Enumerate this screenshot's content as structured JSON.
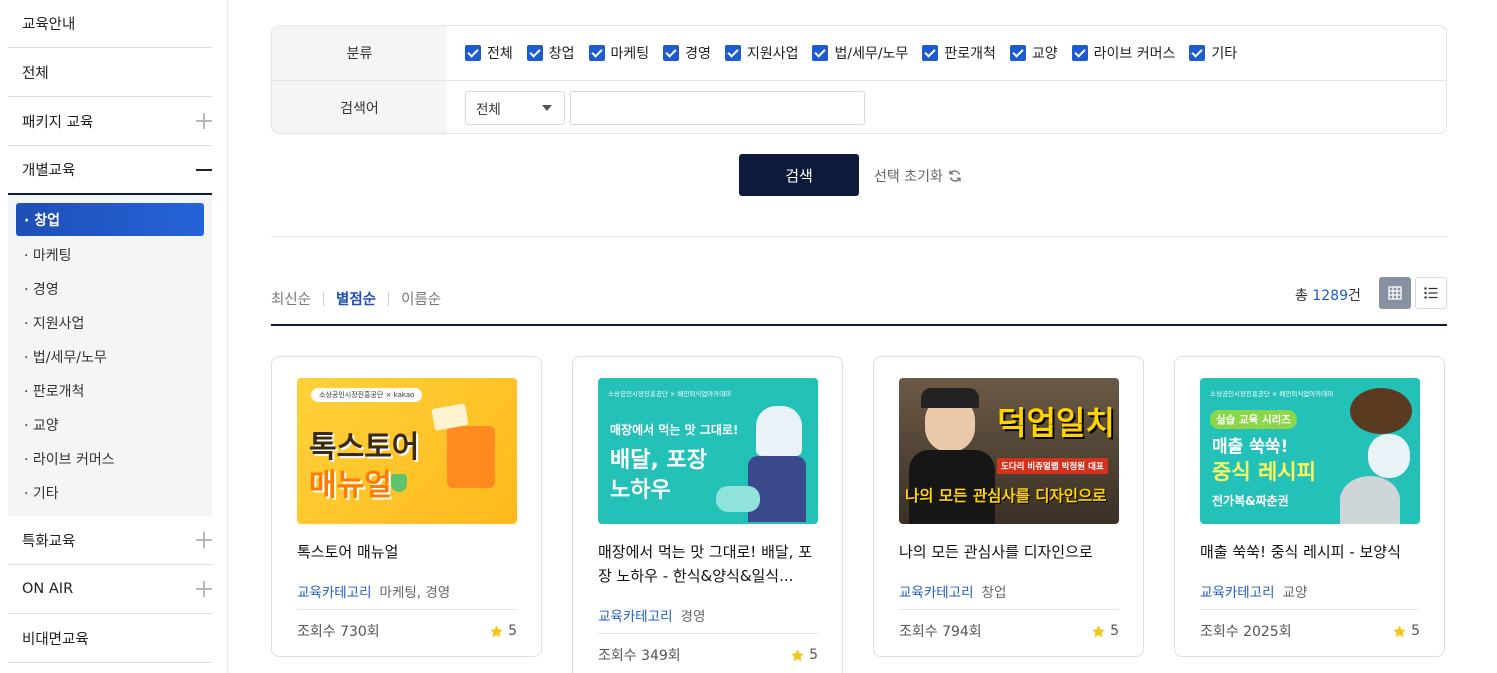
{
  "sidebar": {
    "items": [
      {
        "label": "교육안내"
      },
      {
        "label": "전체"
      },
      {
        "label": "패키지 교육"
      },
      {
        "label": "개별교육"
      },
      {
        "label": "특화교육"
      },
      {
        "label": "ON AIR"
      },
      {
        "label": "비대면교육"
      }
    ],
    "sub_items": [
      {
        "label": "· 창업"
      },
      {
        "label": "· 마케팅"
      },
      {
        "label": "· 경영"
      },
      {
        "label": "· 지원사업"
      },
      {
        "label": "· 법/세무/노무"
      },
      {
        "label": "· 판로개척"
      },
      {
        "label": "· 교양"
      },
      {
        "label": "· 라이브 커머스"
      },
      {
        "label": "· 기타"
      }
    ]
  },
  "filter": {
    "category_label": "분류",
    "categories": [
      "전체",
      "창업",
      "마케팅",
      "경영",
      "지원사업",
      "법/세무/노무",
      "판로개척",
      "교양",
      "라이브 커머스",
      "기타"
    ],
    "keyword_label": "검색어",
    "keyword_select": "전체",
    "keyword_value": ""
  },
  "actions": {
    "search": "검색",
    "reset": "선택 초기화"
  },
  "sort": {
    "options": [
      "최신순",
      "별점순",
      "이름순"
    ],
    "active": "별점순"
  },
  "total": {
    "prefix": "총 ",
    "count": "1289",
    "suffix": "건"
  },
  "colors": {
    "navy": "#0e1a3a",
    "accent": "#1f5bd0",
    "star": "#f5c518"
  },
  "cards": [
    {
      "title": "톡스토어 매뉴얼",
      "category_label": "교육카테고리",
      "category": "마케팅, 경영",
      "views": "조회수 730회",
      "rating": "5",
      "thumb": {
        "logos": "소상공인시장진흥공단 × kakao",
        "line1": "톡스토어",
        "line2": "매뉴얼"
      }
    },
    {
      "title": "매장에서 먹는 맛 그대로! 배달, 포장 노하우 - 한식&양식&일식...",
      "category_label": "교육카테고리",
      "category": "경영",
      "views": "조회수 349회",
      "rating": "5",
      "thumb": {
        "logos": "소상공인시장진흥공단 × 배민외식업아카데미",
        "line1": "매장에서 먹는 맛 그대로!",
        "line2": "배달, 포장",
        "line3": "노하우"
      }
    },
    {
      "title": "나의 모든 관심사를 디자인으로",
      "category_label": "교육카테고리",
      "category": "창업",
      "views": "조회수 794회",
      "rating": "5",
      "thumb": {
        "line1": "덕업일치",
        "line2": "도다리 비쥬얼랩 박정원 대표",
        "line3": "나의 모든 관심사를 디자인으로"
      }
    },
    {
      "title": "매출 쑥쑥! 중식 레시피 - 보양식",
      "category_label": "교육카테고리",
      "category": "교양",
      "views": "조회수 2025회",
      "rating": "5",
      "thumb": {
        "logos": "소상공인시장진흥공단 × 배민외식업아카데미",
        "badge": "실습 교육 시리즈",
        "line1": "매출 쑥쑥!",
        "line2": "중식 레시피",
        "line3": "전가복&짜춘권"
      }
    }
  ]
}
